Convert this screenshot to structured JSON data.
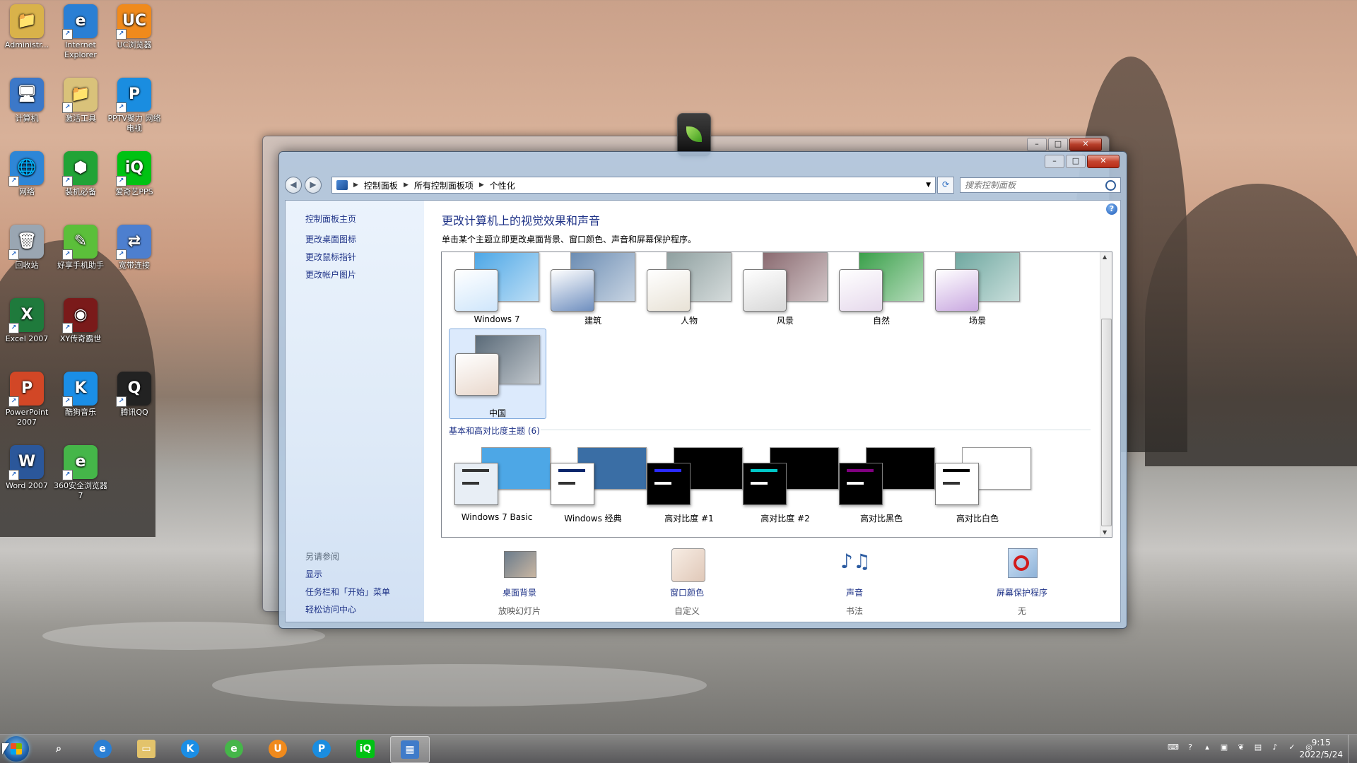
{
  "desktop": {
    "icons": [
      {
        "label": "Administr...",
        "color": "#d9b24a",
        "glyph": "📁"
      },
      {
        "label": "Internet Explorer",
        "color": "#2a7fd4",
        "glyph": "e"
      },
      {
        "label": "UC浏览器",
        "color": "#f08a1c",
        "glyph": "UC"
      },
      {
        "label": "计算机",
        "color": "#3c78c8",
        "glyph": "🖥"
      },
      {
        "label": "激活工具",
        "color": "#d9c27a",
        "glyph": "📁"
      },
      {
        "label": "PPTV聚力 网络电视",
        "color": "#1a8de0",
        "glyph": "P"
      },
      {
        "label": "网络",
        "color": "#2e86d6",
        "glyph": "🌐"
      },
      {
        "label": "装机必备",
        "color": "#21a336",
        "glyph": "⬢"
      },
      {
        "label": "爱奇艺PPS",
        "color": "#00c213",
        "glyph": "iQ"
      },
      {
        "label": "回收站",
        "color": "#9aa6b2",
        "glyph": "🗑"
      },
      {
        "label": "好享手机助手",
        "color": "#5bbf3a",
        "glyph": "✎"
      },
      {
        "label": "宽带连接",
        "color": "#4d7fcf",
        "glyph": "⇄"
      },
      {
        "label": "Excel 2007",
        "color": "#1f7a3c",
        "glyph": "X"
      },
      {
        "label": "XY传奇霸世",
        "color": "#7a1a1a",
        "glyph": "◉"
      },
      {
        "label": "PowerPoint 2007",
        "color": "#d24726",
        "glyph": "P"
      },
      {
        "label": "酷狗音乐",
        "color": "#1a8ee6",
        "glyph": "K"
      },
      {
        "label": "腾讯QQ",
        "color": "#222222",
        "glyph": "Q"
      },
      {
        "label": "Word 2007",
        "color": "#2b579a",
        "glyph": "W"
      },
      {
        "label": "360安全浏览器7",
        "color": "#45b649",
        "glyph": "e"
      }
    ]
  },
  "window": {
    "address": {
      "crumbs": [
        "控制面板",
        "所有控制面板项",
        "个性化"
      ]
    },
    "search_placeholder": "搜索控制面板",
    "leftnav": {
      "home": "控制面板主页",
      "links": [
        "更改桌面图标",
        "更改鼠标指针",
        "更改帐户图片"
      ],
      "see_also": "另请参阅",
      "see_links": [
        "显示",
        "任务栏和「开始」菜单",
        "轻松访问中心"
      ]
    },
    "title": "更改计算机上的视觉效果和声音",
    "subtitle": "单击某个主题立即更改桌面背景、窗口颜色、声音和屏幕保护程序。",
    "aero_themes": [
      {
        "label": "Windows 7",
        "back": "#4da7e6",
        "front": "#cfe6fb"
      },
      {
        "label": "建筑",
        "back": "#6c8db3",
        "front": "#6f8fbf"
      },
      {
        "label": "人物",
        "back": "#8fa0a0",
        "front": "#e8e2d6"
      },
      {
        "label": "风景",
        "back": "#8a6a70",
        "front": "#d8d8d8"
      },
      {
        "label": "自然",
        "back": "#3aa04a",
        "front": "#e6d9ec"
      },
      {
        "label": "场景",
        "back": "#6fa8a0",
        "front": "#c9a8e0"
      }
    ],
    "selected_theme": {
      "label": "中国",
      "back": "#5a6a78",
      "front": "#e9d8cc"
    },
    "basic_group_label": "基本和高对比度主题 (6)",
    "basic_themes": [
      {
        "label": "Windows 7 Basic",
        "back": "#4da7e6",
        "front": "#e8eef5",
        "bar": "#333333"
      },
      {
        "label": "Windows 经典",
        "back": "#3a6ea5",
        "front": "#ffffff",
        "bar": "#0a246a"
      },
      {
        "label": "高对比度 #1",
        "back": "#000000",
        "front": "#000000",
        "bar": "#2a2aff"
      },
      {
        "label": "高对比度 #2",
        "back": "#000000",
        "front": "#000000",
        "bar": "#00c8c8"
      },
      {
        "label": "高对比黑色",
        "back": "#000000",
        "front": "#000000",
        "bar": "#800080"
      },
      {
        "label": "高对比白色",
        "back": "#ffffff",
        "front": "#ffffff",
        "bar": "#000000"
      }
    ],
    "bottom": [
      {
        "label": "桌面背景",
        "sub": "放映幻灯片"
      },
      {
        "label": "窗口颜色",
        "sub": "自定义"
      },
      {
        "label": "声音",
        "sub": "书法"
      },
      {
        "label": "屏幕保护程序",
        "sub": "无"
      }
    ]
  },
  "taskbar": {
    "time": "9:15",
    "date": "2022/5/24"
  }
}
